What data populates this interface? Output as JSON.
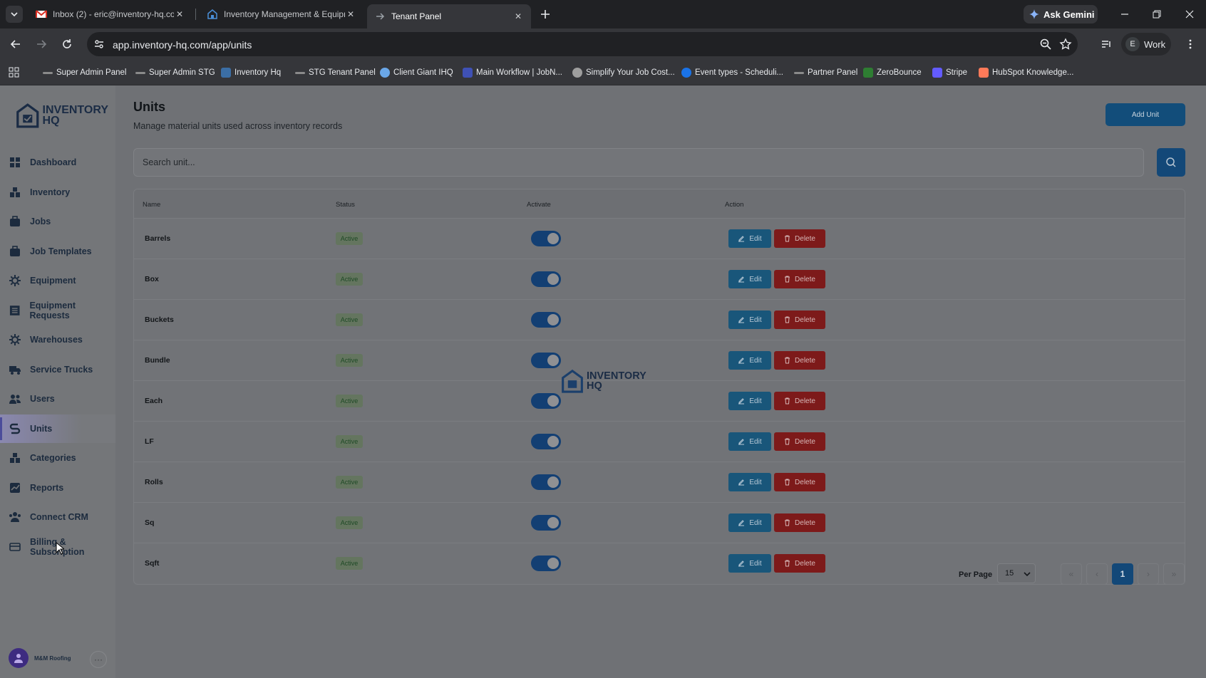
{
  "browser": {
    "tabs": [
      {
        "title": "Inbox (2) - eric@inventory-hq.com",
        "icon": "gmail-icon"
      },
      {
        "title": "Inventory Management & Equipment",
        "icon": "inventory-hq-icon"
      },
      {
        "title": "Tenant Panel",
        "icon": "arrow-icon",
        "active": true
      }
    ],
    "gemini_label": "Ask Gemini",
    "url": "app.inventory-hq.com/app/units",
    "profile_initial": "E",
    "profile_label": "Work",
    "bookmarks": [
      {
        "label": "Super Admin Panel",
        "color": "#8a8a8a"
      },
      {
        "label": "Super Admin STG",
        "color": "#8a8a8a"
      },
      {
        "label": "Inventory Hq",
        "color": "#3b6ea5"
      },
      {
        "label": "STG Tenant Panel",
        "color": "#8a8a8a"
      },
      {
        "label": "Client Giant IHQ",
        "color": "#6aa7e8"
      },
      {
        "label": "Main Workflow | JobN...",
        "color": "#3f51b5"
      },
      {
        "label": "Simplify Your Job Cost...",
        "color": "#9e9e9e"
      },
      {
        "label": "Event types - Scheduli...",
        "color": "#1a73e8"
      },
      {
        "label": "Partner Panel",
        "color": "#8a8a8a"
      },
      {
        "label": "ZeroBounce",
        "color": "#2e7d32"
      },
      {
        "label": "Stripe",
        "color": "#635bff"
      },
      {
        "label": "HubSpot Knowledge...",
        "color": "#ff7a59"
      }
    ]
  },
  "brand": {
    "line1": "INVENTORY",
    "line2": "HQ"
  },
  "sidebar": {
    "items": [
      {
        "label": "Dashboard",
        "icon": "dashboard-icon"
      },
      {
        "label": "Inventory",
        "icon": "inventory-icon"
      },
      {
        "label": "Jobs",
        "icon": "jobs-icon"
      },
      {
        "label": "Job Templates",
        "icon": "job-templates-icon"
      },
      {
        "label": "Equipment",
        "icon": "equipment-icon"
      },
      {
        "label": "Equipment Requests",
        "icon": "equipment-requests-icon"
      },
      {
        "label": "Warehouses",
        "icon": "warehouses-icon"
      },
      {
        "label": "Service Trucks",
        "icon": "truck-icon"
      },
      {
        "label": "Users",
        "icon": "users-icon"
      },
      {
        "label": "Units",
        "icon": "units-icon",
        "active": true
      },
      {
        "label": "Categories",
        "icon": "categories-icon"
      },
      {
        "label": "Reports",
        "icon": "reports-icon"
      },
      {
        "label": "Connect CRM",
        "icon": "crm-icon"
      },
      {
        "label": "Billing & Subscription",
        "icon": "billing-icon"
      }
    ],
    "user_name": "M&M Roofing",
    "more": "···"
  },
  "page": {
    "title": "Units",
    "subtitle": "Manage material units used across inventory records",
    "add_button": "Add Unit",
    "search_placeholder": "Search unit..."
  },
  "table": {
    "headers": [
      "Name",
      "Status",
      "Activate",
      "Action"
    ],
    "edit_label": "Edit",
    "delete_label": "Delete",
    "rows": [
      {
        "name": "Barrels",
        "status": "Active",
        "activated": true
      },
      {
        "name": "Box",
        "status": "Active",
        "activated": true
      },
      {
        "name": "Buckets",
        "status": "Active",
        "activated": true
      },
      {
        "name": "Bundle",
        "status": "Active",
        "activated": true
      },
      {
        "name": "Each",
        "status": "Active",
        "activated": true
      },
      {
        "name": "LF",
        "status": "Active",
        "activated": true
      },
      {
        "name": "Rolls",
        "status": "Active",
        "activated": true
      },
      {
        "name": "Sq",
        "status": "Active",
        "activated": true
      },
      {
        "name": "Sqft",
        "status": "Active",
        "activated": true
      }
    ]
  },
  "pagination": {
    "per_page_label": "Per Page",
    "per_page_value": "15",
    "first": "«",
    "prev": "‹",
    "current": "1",
    "next": "›",
    "last": "»"
  }
}
